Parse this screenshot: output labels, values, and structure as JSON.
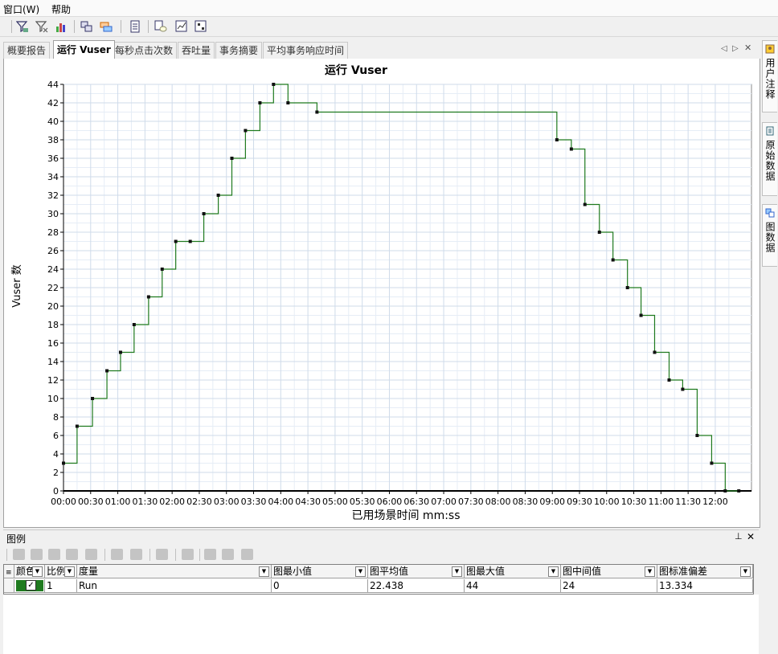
{
  "menu": {
    "window": "窗口(W)",
    "help": "帮助"
  },
  "tabs": [
    {
      "label": "概要报告",
      "active": false
    },
    {
      "label": "运行 Vuser",
      "active": true
    },
    {
      "label": "每秒点击次数",
      "active": false
    },
    {
      "label": "吞吐量",
      "active": false
    },
    {
      "label": "事务摘要",
      "active": false
    },
    {
      "label": "平均事务响应时间",
      "active": false
    }
  ],
  "tab_controls": {
    "prev": "◁",
    "next": "▷",
    "close": "✕"
  },
  "side_panels": [
    {
      "label": "用户注释"
    },
    {
      "label": "原始数据"
    },
    {
      "label": "图数据"
    }
  ],
  "legend": {
    "title": "图例",
    "pin": "📌",
    "close": "✕",
    "columns": [
      "颜色",
      "比例",
      "度量",
      "图最小值",
      "图平均值",
      "图最大值",
      "图中间值",
      "图标准偏差"
    ],
    "rows": [
      {
        "color": "#1f7a1f",
        "checked": "✓",
        "scale": "1",
        "measure": "Run",
        "min": "0",
        "avg": "22.438",
        "max": "44",
        "median": "24",
        "stddev": "13.334"
      }
    ]
  },
  "chart_data": {
    "type": "line",
    "title": "运行 Vuser",
    "xlabel": "已用场景时间 mm:ss",
    "ylabel": "Vuser 数",
    "line_color": "#1f7a1f",
    "grid": true,
    "xlim": [
      0,
      760
    ],
    "ylim": [
      0,
      44
    ],
    "x_ticks": [
      "00:00",
      "00:30",
      "01:00",
      "01:30",
      "02:00",
      "02:30",
      "03:00",
      "03:30",
      "04:00",
      "04:30",
      "05:00",
      "05:30",
      "06:00",
      "06:30",
      "07:00",
      "07:30",
      "08:00",
      "08:30",
      "09:00",
      "09:30",
      "10:00",
      "10:30",
      "11:00",
      "11:30",
      "12:00"
    ],
    "y_ticks": [
      0,
      2,
      4,
      6,
      8,
      10,
      12,
      14,
      16,
      18,
      20,
      22,
      24,
      26,
      28,
      30,
      32,
      34,
      36,
      38,
      40,
      42,
      44
    ],
    "series": [
      {
        "name": "Run",
        "step": true,
        "points": [
          [
            "00:00",
            3
          ],
          [
            "00:15",
            7
          ],
          [
            "00:32",
            10
          ],
          [
            "00:48",
            13
          ],
          [
            "01:03",
            15
          ],
          [
            "01:18",
            18
          ],
          [
            "01:34",
            21
          ],
          [
            "01:49",
            24
          ],
          [
            "02:04",
            27
          ],
          [
            "02:20",
            27
          ],
          [
            "02:35",
            30
          ],
          [
            "02:51",
            32
          ],
          [
            "03:06",
            36
          ],
          [
            "03:21",
            39
          ],
          [
            "03:37",
            42
          ],
          [
            "03:52",
            44
          ],
          [
            "04:08",
            42
          ],
          [
            "04:40",
            41
          ],
          [
            "09:05",
            38
          ],
          [
            "09:21",
            37
          ],
          [
            "09:36",
            31
          ],
          [
            "09:52",
            28
          ],
          [
            "10:07",
            25
          ],
          [
            "10:23",
            22
          ],
          [
            "10:38",
            19
          ],
          [
            "10:53",
            15
          ],
          [
            "11:09",
            12
          ],
          [
            "11:24",
            11
          ],
          [
            "11:40",
            6
          ],
          [
            "11:56",
            3
          ],
          [
            "12:11",
            0
          ],
          [
            "12:26",
            0
          ]
        ]
      }
    ]
  }
}
